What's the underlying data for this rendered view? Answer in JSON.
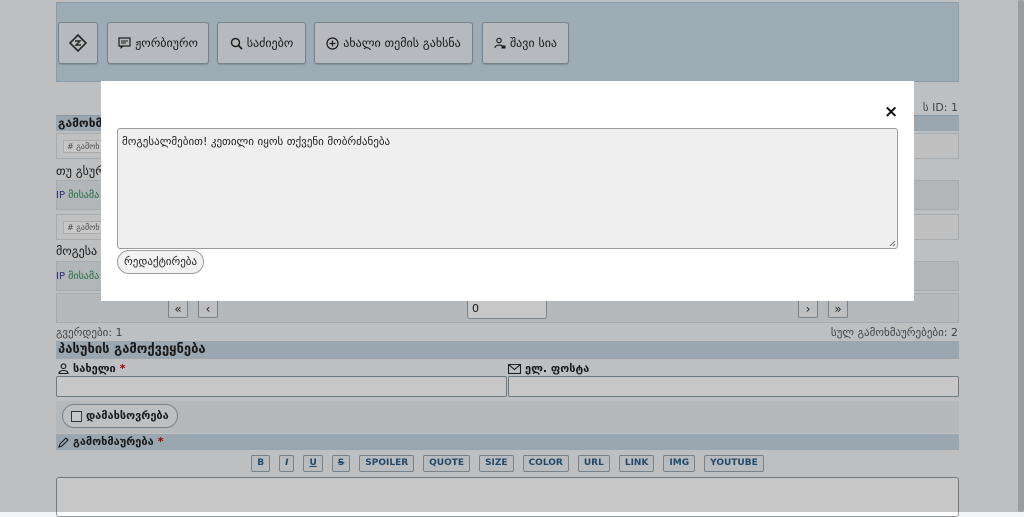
{
  "toolbar": {
    "buttons": [
      {
        "label": ""
      },
      {
        "label": "ჟორბიურო"
      },
      {
        "label": "საძიებო"
      },
      {
        "label": "ახალი თემის გახსნა"
      },
      {
        "label": "შავი სია"
      }
    ]
  },
  "topic": {
    "id_text": "ს ID: 1",
    "heading": "გამოხმ",
    "posts": [
      {
        "tag": "# გამოხ",
        "text": "თუ გსურ",
        "ip": "IP",
        "ip_rest": "მისამა"
      },
      {
        "tag": "# გამოხ",
        "text": "მოგესა",
        "ip": "IP",
        "ip_rest": "მისამა"
      }
    ]
  },
  "pager": {
    "first": "«",
    "prev": "‹",
    "next": "›",
    "last": "»",
    "page_value": "0",
    "pages_label": "გვერდები: 1",
    "total_label": "სულ გამოხმაურებები: 2"
  },
  "reply": {
    "title": "პასუხის გამოქვეყნება",
    "name_label": "სახელი",
    "email_label": "ელ. ფოსტა",
    "required_mark": "*",
    "remember_label": "დამახსოვრება",
    "message_label": "გამოხმაურება",
    "format_buttons": [
      "B",
      "I",
      "U",
      "S",
      "SPOILER",
      "QUOTE",
      "SIZE",
      "COLOR",
      "URL",
      "LINK",
      "IMG",
      "YOUTUBE"
    ]
  },
  "modal": {
    "close_label": "×",
    "text": "მოგესალმებით! კეთილი იყოს თქვენი მობრძანება",
    "edit_label": "რედაქტირება"
  }
}
